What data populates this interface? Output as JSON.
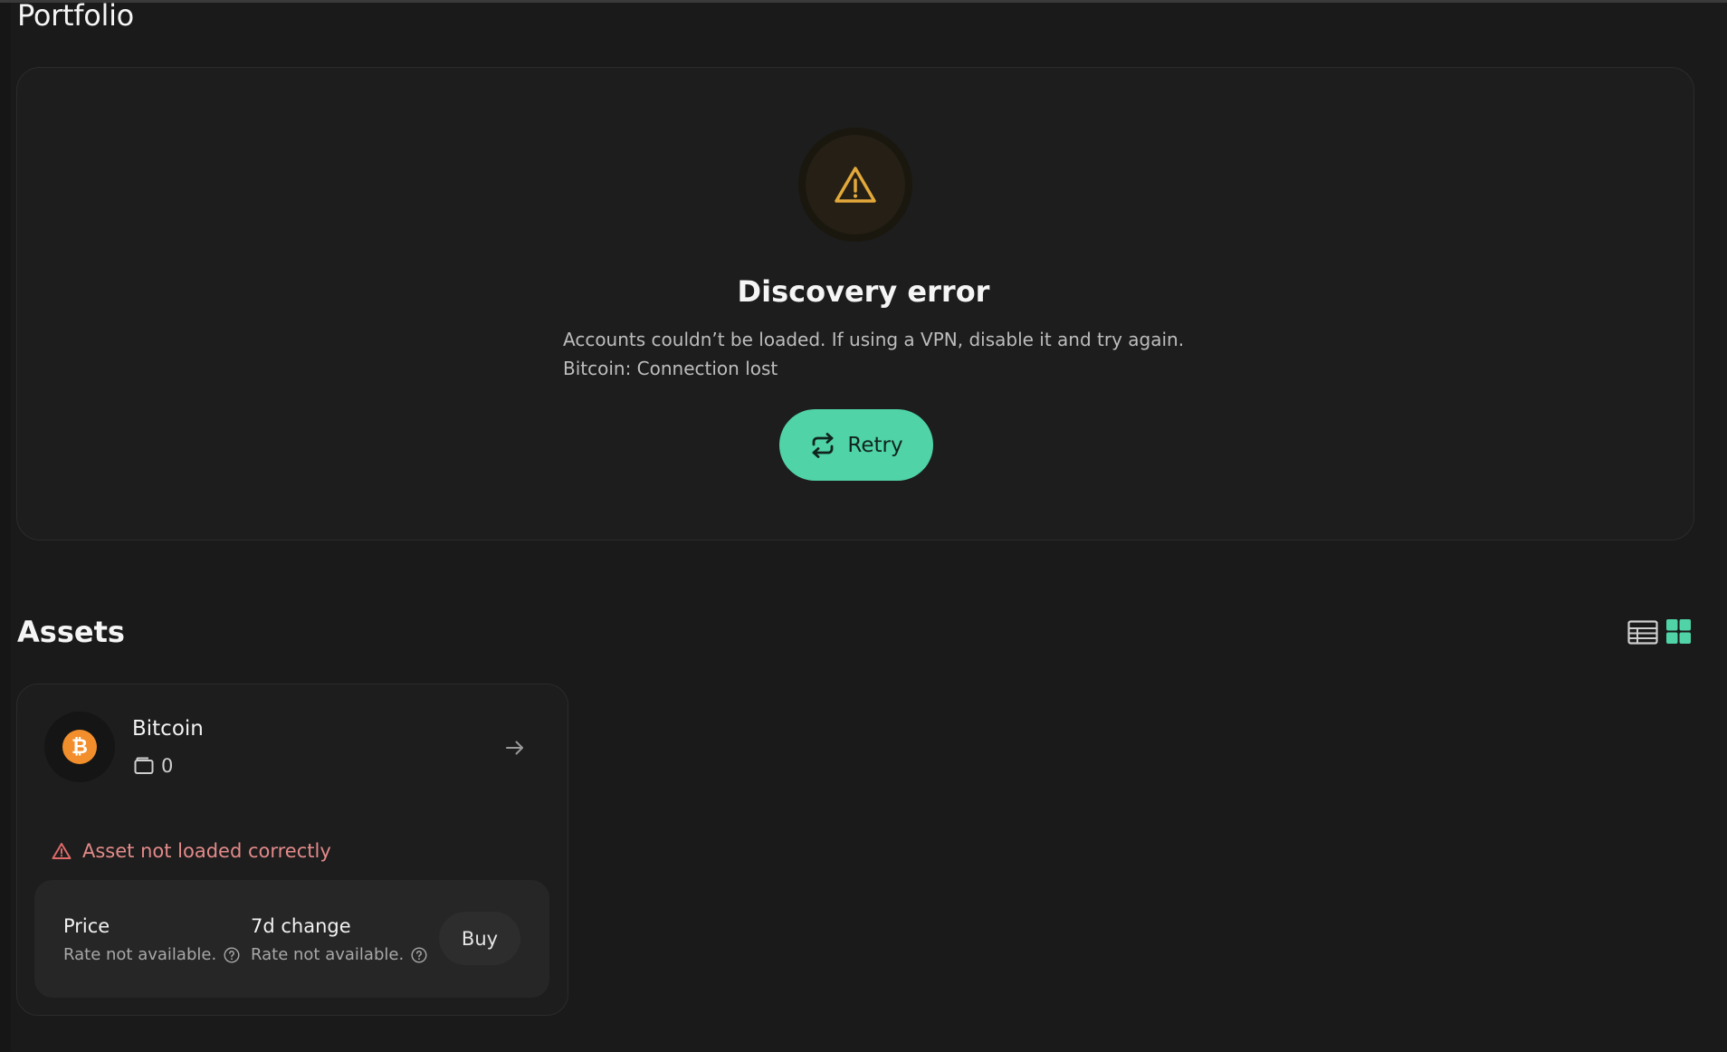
{
  "page": {
    "title": "Portfolio"
  },
  "discovery_error": {
    "title": "Discovery error",
    "message_line1": "Accounts couldn’t be loaded. If using a VPN, disable it and try again.",
    "message_line2": "Bitcoin: Connection lost",
    "retry_label": "Retry",
    "icon": "warning-triangle-icon"
  },
  "assets": {
    "title": "Assets",
    "view_modes": [
      "list",
      "grid"
    ],
    "active_view": "grid",
    "items": [
      {
        "name": "Bitcoin",
        "symbol_glyph": "₿",
        "account_count": "0",
        "warning": "Asset not loaded correctly",
        "price_label": "Price",
        "price_value": "Rate not available.",
        "change_label": "7d change",
        "change_value": "Rate not available.",
        "buy_label": "Buy"
      }
    ]
  },
  "colors": {
    "background": "#1a1a1a",
    "accent": "#4fd3a7",
    "warning": "#e3a83a",
    "error_text": "#e38a8a",
    "bitcoin": "#f28f2c"
  }
}
